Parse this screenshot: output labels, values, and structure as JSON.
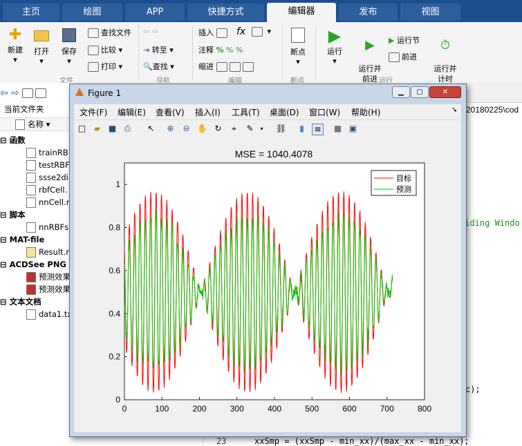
{
  "app_tabs": [
    "主页",
    "绘图",
    "APP",
    "快捷方式",
    "编辑器",
    "发布",
    "视图"
  ],
  "ribbon": {
    "file": {
      "new": "新建",
      "open": "打开",
      "save": "保存",
      "find_files": "查找文件",
      "compare": "比较",
      "print": "打印",
      "section": "文件"
    },
    "nav": {
      "goto": "转至",
      "find": "查找",
      "section": "导航"
    },
    "edit": {
      "insert": "插入",
      "comment": "注释",
      "indent": "缩进",
      "fx": "fx",
      "section": "编辑"
    },
    "breakpoints": {
      "label": "断点",
      "section": "断点"
    },
    "run": {
      "run": "运行",
      "run_advance": "运行并\n前进",
      "run_section": "运行节",
      "advance": "前进",
      "run_time": "运行并\n计时",
      "section": "运行"
    }
  },
  "left_panel": {
    "title": "当前文件夹",
    "col_header": "名称",
    "groups": [
      {
        "label": "函数",
        "items": [
          "trainRB",
          "testRBF",
          "ssse2di",
          "rbfCell.",
          "nnCell.r"
        ]
      },
      {
        "label": "脚本",
        "items": [
          "nnRBFs"
        ]
      },
      {
        "label": "MAT-file",
        "items": [
          "Result.n"
        ]
      },
      {
        "label": "ACDSee PNG",
        "items": [
          "预测效果",
          "预测效果"
        ]
      },
      {
        "label": "文本文档",
        "items": [
          "data1.tx"
        ]
      }
    ]
  },
  "editor": {
    "path_tail": "20180225\\cod",
    "code_fragment_1": "liding Windo",
    "code_fragment_2": "c);",
    "line_number": "23",
    "line_23": "xxSmp = (xxSmp - min_xx)/(max_xx - min_xx);"
  },
  "figure": {
    "title": "Figure 1",
    "menu": [
      "文件(F)",
      "编辑(E)",
      "查看(V)",
      "插入(I)",
      "工具(T)",
      "桌面(D)",
      "窗口(W)",
      "帮助(H)"
    ]
  },
  "chart_data": {
    "type": "line",
    "title": "MSE = 1040.4078",
    "xlabel": "",
    "ylabel": "",
    "xlim": [
      0,
      800
    ],
    "ylim": [
      0,
      1.1
    ],
    "xticks": [
      0,
      100,
      200,
      300,
      400,
      500,
      600,
      700,
      800
    ],
    "yticks": [
      0,
      0.2,
      0.4,
      0.6,
      0.8,
      1
    ],
    "legend_position": "top-right",
    "series": [
      {
        "name": "目标",
        "color": "#ff0000",
        "x_start": 0,
        "x_end": 715,
        "period": 14.3,
        "carrier_phase": 0.6,
        "amp_params": {
          "center": 0.5,
          "depth": 0.47,
          "freq": 0.0126,
          "phase": -1.0
        },
        "noise": 0.0
      },
      {
        "name": "预测",
        "color": "#00cc00",
        "x_start": 0,
        "x_end": 715,
        "period": 14.3,
        "carrier_phase": 0.6,
        "amp_params": {
          "center": 0.5,
          "depth": 0.36,
          "freq": 0.0126,
          "phase": -1.0
        },
        "noise": 0.06
      }
    ]
  }
}
